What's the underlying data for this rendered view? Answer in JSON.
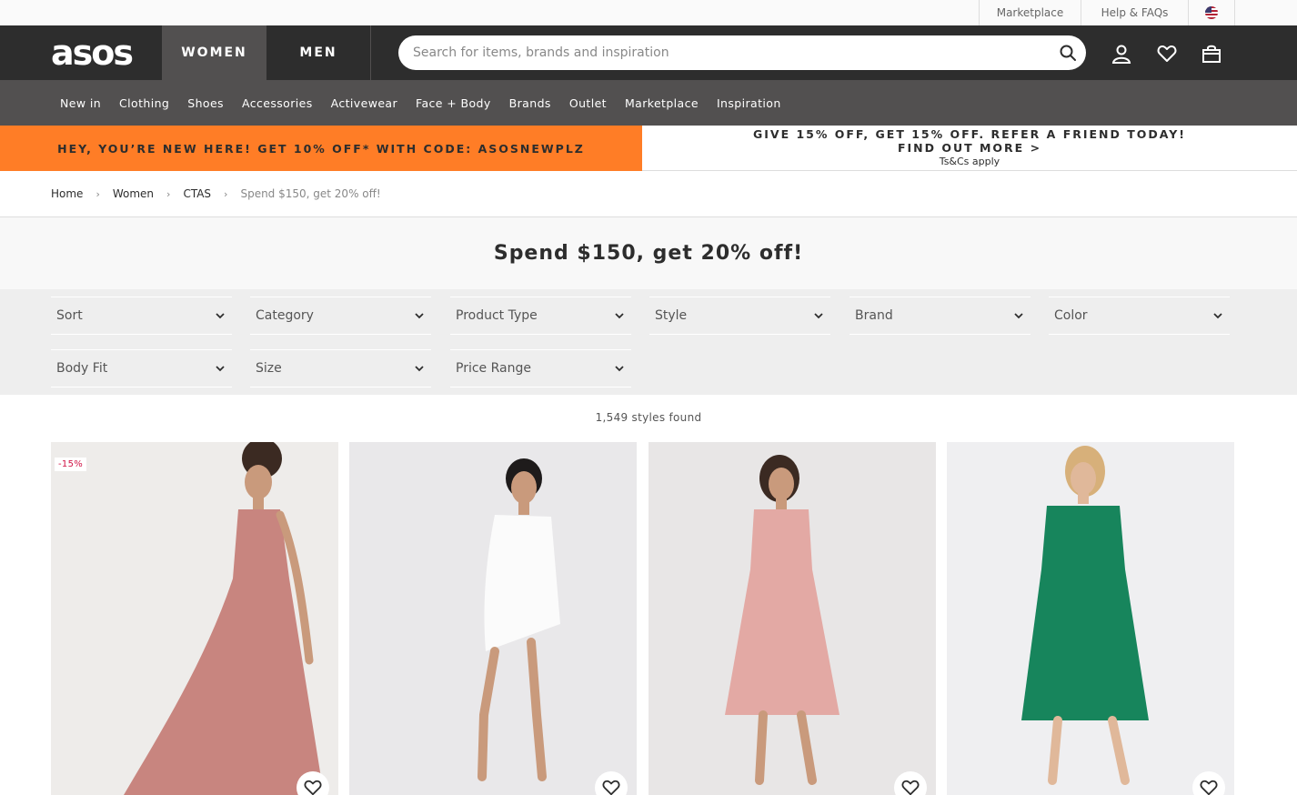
{
  "utility_bar": {
    "marketplace": "Marketplace",
    "help": "Help & FAQs",
    "region_icon": "us-flag-icon"
  },
  "header": {
    "logo": "asos",
    "tabs": [
      "WOMEN",
      "MEN"
    ],
    "search_placeholder": "Search for items, brands and inspiration",
    "icons": [
      "search-icon",
      "account-icon",
      "heart-icon",
      "bag-icon"
    ]
  },
  "category_nav": [
    "New in",
    "Clothing",
    "Shoes",
    "Accessories",
    "Activewear",
    "Face + Body",
    "Brands",
    "Outlet",
    "Marketplace",
    "Inspiration"
  ],
  "promo": {
    "left": "HEY, YOU’RE NEW HERE! GET 10% OFF* WITH CODE: ASOSNEWPLZ",
    "right_line1": "GIVE 15% OFF, GET 15% OFF. REFER A FRIEND TODAY!",
    "right_line2": "FIND OUT MORE >",
    "right_line3": "Ts&Cs apply"
  },
  "breadcrumb": [
    "Home",
    "Women",
    "CTAS",
    "Spend $150, get 20% off!"
  ],
  "page_title": "Spend $150, get 20% off!",
  "filters": [
    "Sort",
    "Category",
    "Product Type",
    "Style",
    "Brand",
    "Color",
    "Body Fit",
    "Size",
    "Price Range"
  ],
  "results_count": "1,549 styles found",
  "products": [
    {
      "badge": "-15%",
      "dress_color": "#c8857f"
    },
    {
      "badge": "",
      "dress_color": "#fbfbfb"
    },
    {
      "badge": "",
      "dress_color": "#e3a9a4"
    },
    {
      "badge": "",
      "dress_color": "#17855c"
    }
  ],
  "colors": {
    "header_bg": "#2d2d2d",
    "nav_bg": "#525050",
    "promo_orange": "#ff7d26",
    "sale_red": "#d01345"
  }
}
